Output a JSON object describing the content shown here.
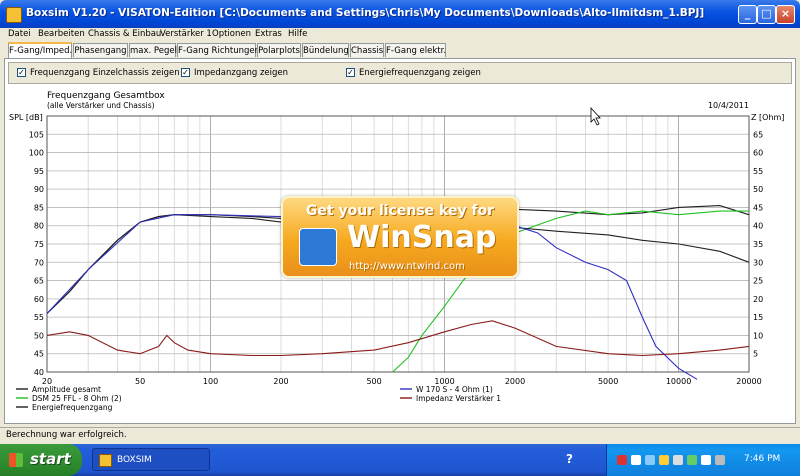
{
  "window": {
    "title": "Boxsim V1.20 - VISATON-Edition [C:\\Documents and Settings\\Chris\\My Documents\\Downloads\\Alto-Ilmitdsm_1.BPJ]"
  },
  "menu": [
    "Datei",
    "Bearbeiten",
    "Chassis & Einbau",
    "Verstärker 1",
    "Optionen",
    "Extras",
    "Hilfe"
  ],
  "tabs": [
    "F-Gang/Imped.",
    "Phasengang",
    "max. Pegel",
    "F-Gang Richtungen",
    "Polarplots",
    "Bündelung",
    "Chassis",
    "F-Gang elektr."
  ],
  "active_tab": 0,
  "options": [
    {
      "label": "Frequenzgang Einzelchassis zeigen",
      "checked": true
    },
    {
      "label": "Impedanzgang zeigen",
      "checked": true
    },
    {
      "label": "Energiefrequenzgang zeigen",
      "checked": true
    }
  ],
  "status": "Berechnung war erfolgreich.",
  "taskbar": {
    "start": "start",
    "task": "BOXSIM",
    "clock": "7:46 PM"
  },
  "watermark": {
    "line1": "Get your license key for",
    "brand": "WinSnap",
    "url": "http://www.ntwind.com"
  },
  "chart_data": {
    "type": "line",
    "title": "Frequenzgang Gesamtbox",
    "subtitle": "(alle Verstärker und Chassis)",
    "date": "10/4/2011",
    "ylabel": "SPL [dB]",
    "y2label": "Z [Ohm]",
    "xscale": "log",
    "xlim": [
      20,
      20000
    ],
    "ylim": [
      40,
      110
    ],
    "y2lim": [
      0,
      70
    ],
    "xticks": [
      20,
      50,
      100,
      200,
      500,
      1000,
      2000,
      5000,
      10000,
      20000
    ],
    "yticks": [
      40,
      45,
      50,
      55,
      60,
      65,
      70,
      75,
      80,
      85,
      90,
      95,
      100,
      105,
      110
    ],
    "y2ticks": [
      5,
      10,
      15,
      20,
      25,
      30,
      35,
      40,
      45,
      50,
      55,
      60,
      65,
      70
    ],
    "grid": true,
    "colors": {
      "amp": "#202020",
      "dsm": "#20c020",
      "energy": "#202020",
      "w170": "#3030c0",
      "imp": "#8b1a1a"
    },
    "series": [
      {
        "key": "amp",
        "name": "Amplitude gesamt",
        "x": [
          20,
          25,
          30,
          40,
          50,
          60,
          70,
          100,
          150,
          200,
          300,
          500,
          700,
          1000,
          1500,
          2000,
          3000,
          5000,
          7000,
          10000,
          15000,
          20000
        ],
        "y": [
          56,
          62,
          68,
          76,
          81,
          82.5,
          83,
          83,
          82.5,
          82,
          83,
          83.5,
          84,
          84.5,
          84,
          84.5,
          84,
          83,
          83.5,
          85,
          85.5,
          83
        ]
      },
      {
        "key": "dsm",
        "name": "DSM 25 FFL - 8 Ohm (2)",
        "x": [
          600,
          700,
          800,
          1000,
          1200,
          1500,
          2000,
          3000,
          4000,
          5000,
          7000,
          10000,
          15000,
          20000
        ],
        "y": [
          40,
          44,
          50,
          58,
          65,
          72,
          78,
          82,
          84,
          83,
          84,
          83,
          84,
          84
        ]
      },
      {
        "key": "energy",
        "name": "Energiefrequenzgang",
        "x": [
          20,
          25,
          30,
          40,
          50,
          60,
          70,
          100,
          150,
          200,
          300,
          500,
          700,
          1000,
          1500,
          2000,
          3000,
          5000,
          7000,
          10000,
          15000,
          20000
        ],
        "y": [
          56,
          62,
          68,
          76,
          81,
          82.5,
          83,
          82.5,
          82,
          81,
          81.5,
          82,
          81,
          80.5,
          80,
          79.5,
          78.5,
          77.5,
          76,
          75,
          73,
          70
        ]
      },
      {
        "key": "w170",
        "name": "W 170 S - 4 Ohm (1)",
        "x": [
          20,
          30,
          50,
          70,
          100,
          200,
          500,
          1000,
          1500,
          2000,
          2500,
          3000,
          4000,
          5000,
          6000,
          7000,
          8000,
          10000,
          12000
        ],
        "y": [
          56,
          68,
          81,
          83,
          83,
          82.5,
          83,
          82.5,
          80.5,
          80,
          78,
          74,
          70,
          68,
          65,
          55,
          47,
          41,
          38
        ]
      },
      {
        "key": "imp",
        "name": "Impedanz Verstärker 1",
        "axis": "y2",
        "x": [
          20,
          25,
          30,
          40,
          50,
          60,
          65,
          70,
          80,
          100,
          150,
          200,
          300,
          500,
          700,
          1000,
          1300,
          1600,
          2000,
          3000,
          5000,
          7000,
          10000,
          15000,
          20000
        ],
        "y": [
          10,
          11,
          10,
          6,
          5,
          7,
          10,
          8,
          6,
          5,
          4.5,
          4.5,
          5,
          6,
          8,
          11,
          13,
          14,
          12,
          7,
          5,
          4.5,
          5,
          6,
          7
        ]
      }
    ],
    "legend": [
      {
        "key": "amp",
        "label": "Amplitude gesamt"
      },
      {
        "key": "w170",
        "label": "W 170 S - 4 Ohm (1)"
      },
      {
        "key": "dsm",
        "label": "DSM 25 FFL - 8 Ohm (2)"
      },
      {
        "key": "imp",
        "label": "Impedanz Verstärker 1"
      },
      {
        "key": "energy",
        "label": "Energiefrequenzgang"
      }
    ]
  }
}
